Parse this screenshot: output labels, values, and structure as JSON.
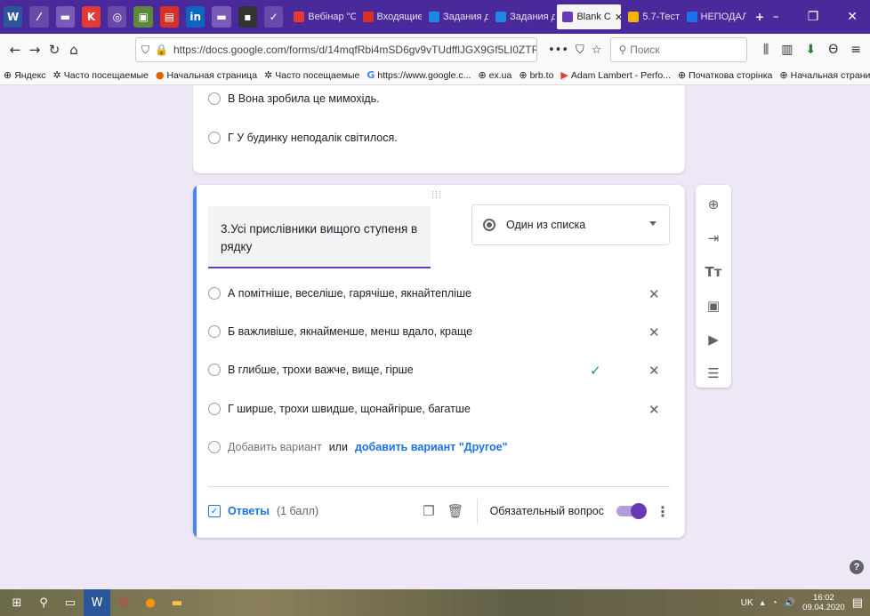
{
  "browser": {
    "tabs": [
      {
        "label": "Вебінар \"С",
        "color": "#e53935"
      },
      {
        "label": "Входящие",
        "color": "#d93025"
      },
      {
        "label": "Задания д",
        "color": "#1e88e5"
      },
      {
        "label": "Задания д",
        "color": "#1e88e5"
      },
      {
        "label": "Blank C",
        "color": "#673ab7",
        "active": true
      },
      {
        "label": "5.7-Тест",
        "color": "#f4b400"
      },
      {
        "label": "НЕПОДАЛ",
        "color": "#1a73e8"
      }
    ],
    "url": "https://docs.google.com/forms/d/14mqfRbi4mSD6gv9vTUdfflJGX9Gf5LI0ZTRC6l",
    "more_label": "•••",
    "search_placeholder": "Поиск",
    "bookmarks": [
      {
        "label": "Яндекс",
        "icon": "globe-icon"
      },
      {
        "label": "Часто посещаемые",
        "icon": "gear-icon"
      },
      {
        "label": "Начальная страница",
        "icon": "firefox-icon"
      },
      {
        "label": "Часто посещаемые",
        "icon": "gear-icon"
      },
      {
        "label": "https://www.google.c...",
        "icon": "google-icon"
      },
      {
        "label": "ex.ua",
        "icon": "globe-icon"
      },
      {
        "label": "brb.to",
        "icon": "globe-icon"
      },
      {
        "label": "Adam Lambert - Perfo...",
        "icon": "youtube-icon"
      },
      {
        "label": "Початкова сторінка",
        "icon": "globe-icon"
      },
      {
        "label": "Начальная страница",
        "icon": "globe-icon"
      }
    ]
  },
  "prev_card": {
    "options": [
      "В Вона зробила це мимохідь.",
      "Г У будинку неподалік світилося."
    ]
  },
  "question": {
    "title": "3.Усі прислівники вищого ступеня в рядку",
    "type_label": "Один из списка",
    "options": [
      {
        "text": "А помітніше, веселіше, гарячіше, якнайтепліше",
        "correct": false
      },
      {
        "text": "Б важливіше, якнайменше, менш вдало, краще",
        "correct": false
      },
      {
        "text": "В глибше, трохи важче, вище, гірше",
        "correct": true
      },
      {
        "text": "Г ширше, трохи швидше, щонайгірше, багатше",
        "correct": false
      }
    ],
    "add_option": "Добавить вариант",
    "or_label": "или",
    "add_other": "добавить вариант \"Другое\"",
    "answers_label": "Ответы",
    "points_label": "(1 балл)",
    "required_label": "Обязательный вопрос",
    "required": true
  },
  "taskbar": {
    "lang": "UK",
    "time": "16:02",
    "date": "09.04.2020"
  }
}
